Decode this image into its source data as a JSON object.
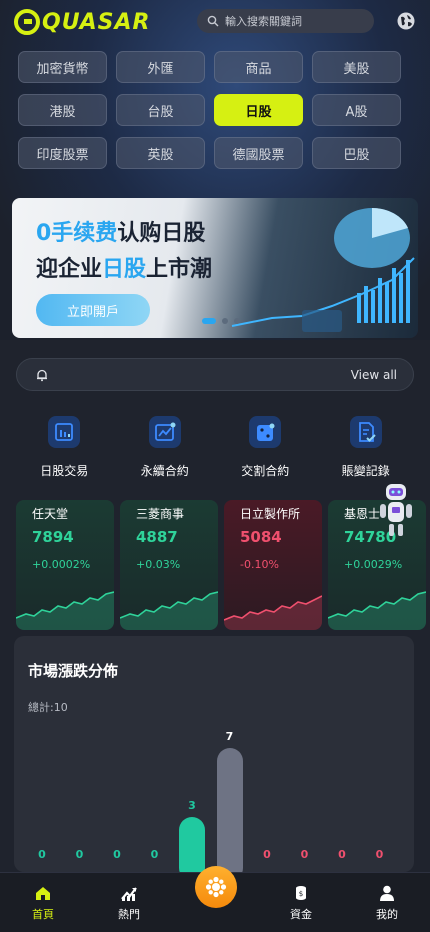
{
  "header": {
    "logo_text_a": "",
    "logo_text_q": "QUASAR",
    "search_placeholder": "輸入搜索關鍵詞"
  },
  "tabs": [
    {
      "label": "加密貨幣",
      "active": false
    },
    {
      "label": "外匯",
      "active": false
    },
    {
      "label": "商品",
      "active": false
    },
    {
      "label": "美股",
      "active": false
    },
    {
      "label": "港股",
      "active": false
    },
    {
      "label": "台股",
      "active": false
    },
    {
      "label": "日股",
      "active": true
    },
    {
      "label": "A股",
      "active": false
    },
    {
      "label": "印度股票",
      "active": false
    },
    {
      "label": "英股",
      "active": false
    },
    {
      "label": "德國股票",
      "active": false
    },
    {
      "label": "巴股",
      "active": false
    }
  ],
  "banner": {
    "line1_hl": "0手续费",
    "line1_rest": "认购日股",
    "line2_a": "迎企业",
    "line2_hl": "日股",
    "line2_b": "上市潮",
    "button": "立即開戶"
  },
  "notice": {
    "view_all": "View all"
  },
  "quick": [
    {
      "label": "日股交易",
      "icon": "chart-bars-icon"
    },
    {
      "label": "永續合約",
      "icon": "trend-line-icon"
    },
    {
      "label": "交割合約",
      "icon": "dice-icon"
    },
    {
      "label": "賬變記錄",
      "icon": "document-check-icon"
    }
  ],
  "stocks": [
    {
      "name": "任天堂",
      "price": "7894",
      "change": "+0.0002%",
      "dir": "up"
    },
    {
      "name": "三菱商事",
      "price": "4887",
      "change": "+0.03%",
      "dir": "up"
    },
    {
      "name": "日立製作所",
      "price": "5084",
      "change": "-0.10%",
      "dir": "down"
    },
    {
      "name": "基恩士",
      "price": "74780",
      "change": "+0.0029%",
      "dir": "up"
    }
  ],
  "distribution": {
    "title": "市場漲跌分佈",
    "total": "總計:10",
    "colors": {
      "up": "#20c9a0",
      "flat": "#6e7384",
      "down": "#f0506e"
    },
    "buckets": [
      {
        "count": 0,
        "kind": "up"
      },
      {
        "count": 0,
        "kind": "up"
      },
      {
        "count": 0,
        "kind": "up"
      },
      {
        "count": 0,
        "kind": "up"
      },
      {
        "count": 3,
        "kind": "up"
      },
      {
        "count": 7,
        "kind": "flat"
      },
      {
        "count": 0,
        "kind": "down"
      },
      {
        "count": 0,
        "kind": "down"
      },
      {
        "count": 0,
        "kind": "down"
      },
      {
        "count": 0,
        "kind": "down"
      }
    ]
  },
  "nav": [
    {
      "label": "首頁",
      "icon": "home-icon",
      "active": true
    },
    {
      "label": "熱門",
      "icon": "chart-up-icon",
      "active": false
    },
    {
      "label": "",
      "icon": "coins-center-icon",
      "active": false
    },
    {
      "label": "資金",
      "icon": "money-stack-icon",
      "active": false
    },
    {
      "label": "我的",
      "icon": "user-icon",
      "active": false
    }
  ],
  "colors": {
    "accent": "#d6f012",
    "up": "#2fd39a",
    "down": "#f0506e"
  }
}
